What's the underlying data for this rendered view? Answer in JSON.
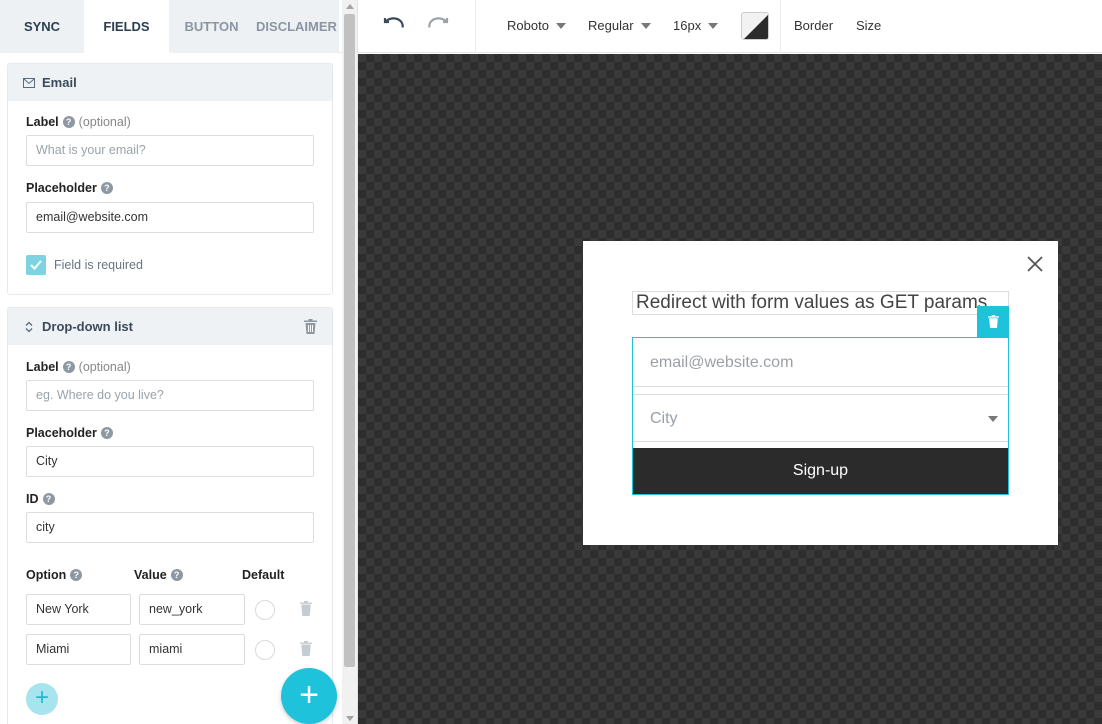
{
  "tabs": [
    {
      "label": "SYNC"
    },
    {
      "label": "FIELDS"
    },
    {
      "label": "BUTTON"
    },
    {
      "label": "DISCLAIMER"
    }
  ],
  "email_card": {
    "title": "Email",
    "label_field": {
      "label": "Label",
      "optional": "(optional)",
      "placeholder": "What is your email?"
    },
    "placeholder_field": {
      "label": "Placeholder",
      "value": "email@website.com"
    },
    "required": {
      "label": "Field is required",
      "checked": true
    }
  },
  "dropdown_card": {
    "title": "Drop-down list",
    "label_field": {
      "label": "Label",
      "optional": "(optional)",
      "placeholder": "eg. Where do you live?"
    },
    "placeholder_field": {
      "label": "Placeholder",
      "value": "City"
    },
    "id_field": {
      "label": "ID",
      "value": "city"
    },
    "columns": {
      "option": "Option",
      "value": "Value",
      "default": "Default"
    },
    "options": [
      {
        "option": "New York",
        "value": "new_york"
      },
      {
        "option": "Miami",
        "value": "miami"
      }
    ]
  },
  "toolbar": {
    "font": "Roboto",
    "weight": "Regular",
    "size": "16px",
    "border": "Border",
    "size_label": "Size",
    "color_swatch": "#2b2b2b"
  },
  "popup": {
    "title": "Redirect with form values as GET params",
    "email_placeholder": "email@website.com",
    "city_placeholder": "City",
    "button": "Sign-up"
  },
  "accent_color": "#1ec3db"
}
